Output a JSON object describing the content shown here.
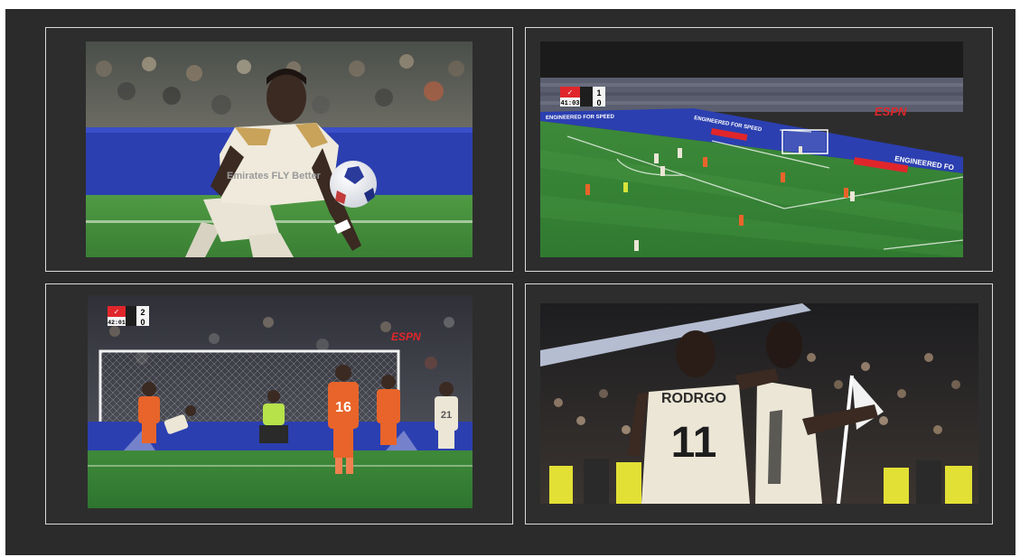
{
  "panels": [
    {
      "id": "player-with-ball",
      "jersey_text": "Emirates FLY Better"
    },
    {
      "id": "wide-pitch-view",
      "scoreboard": {
        "time": "41:03",
        "home_score": "1",
        "away_score": "0"
      },
      "broadcaster": "ESPN",
      "boards": [
        "ENGINEERED FOR SPEED",
        "ENGINEERED FOR SPEED",
        "ENGINEERED FO"
      ]
    },
    {
      "id": "penalty-kick",
      "scoreboard": {
        "time": "42:01",
        "home_score": "2",
        "away_score": "0"
      },
      "broadcaster": "ESPN",
      "shirt_numbers": [
        "16",
        "21"
      ]
    },
    {
      "id": "celebration",
      "shirt_name": "RODRGO",
      "shirt_number": "11"
    }
  ],
  "colors": {
    "background": "#2b2b2b",
    "frame_border": "#d9d9d9",
    "pitch_green": "#3f8a3a",
    "ad_board_blue": "#2b3fb0",
    "opponent_orange": "#e8642a",
    "home_white": "#ece6d6",
    "espn_red": "#e0262b"
  }
}
